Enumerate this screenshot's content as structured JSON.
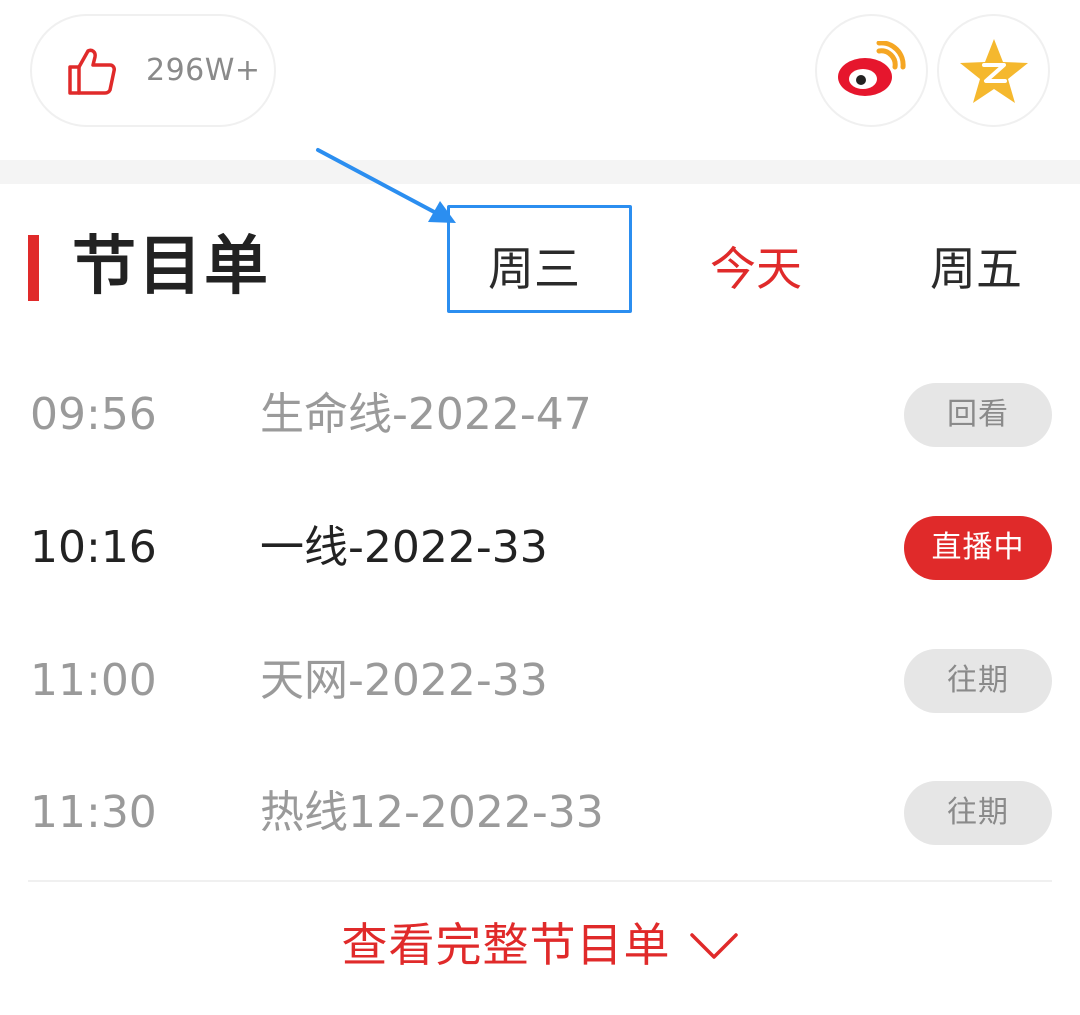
{
  "action_bar": {
    "like_icon": "thumbs-up-icon",
    "like_count": "296W+",
    "share_buttons": [
      {
        "icon": "weibo-icon"
      },
      {
        "icon": "qzone-star-icon"
      }
    ]
  },
  "schedule": {
    "title": "节目单",
    "day_tabs": [
      {
        "label": "周三",
        "selected": false
      },
      {
        "label": "今天",
        "selected": true
      },
      {
        "label": "周五",
        "selected": false
      }
    ],
    "programs": [
      {
        "time": "09:56",
        "name": "生命线-2022-47",
        "status": "回看"
      },
      {
        "time": "10:16",
        "name": "一线-2022-33",
        "status": "直播中"
      },
      {
        "time": "11:00",
        "name": "天网-2022-33",
        "status": "往期"
      },
      {
        "time": "11:30",
        "name": "热线12-2022-33",
        "status": "往期"
      }
    ],
    "view_full_label": "查看完整节目单"
  },
  "colors": {
    "accent_red": "#e02a2a",
    "annotation_blue": "#2b8ef0",
    "muted_text": "#9a9a9a"
  }
}
